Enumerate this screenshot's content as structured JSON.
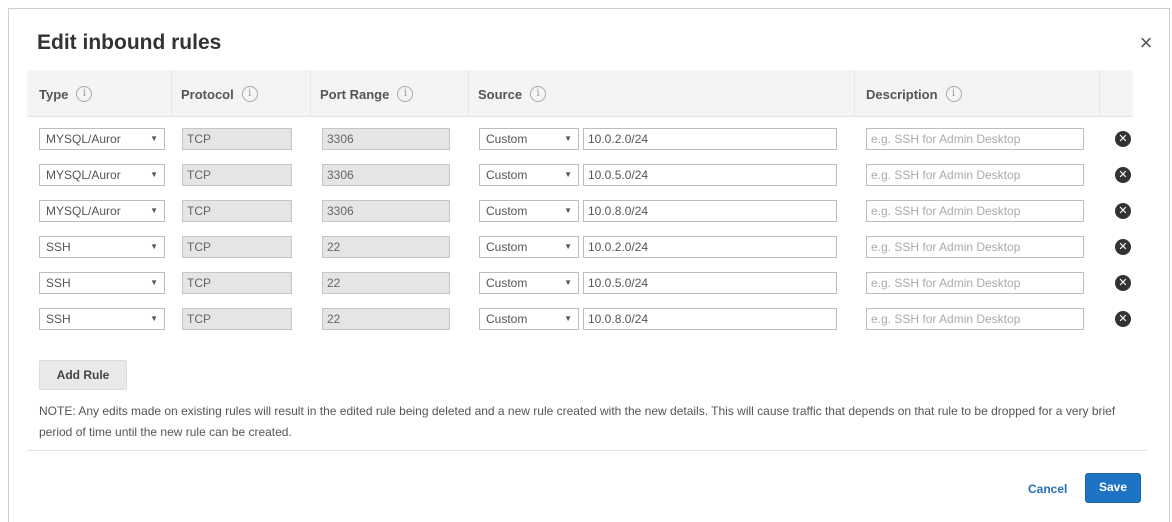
{
  "dialog": {
    "title": "Edit inbound rules",
    "close_glyph": "×"
  },
  "table": {
    "headers": {
      "type": "Type",
      "protocol": "Protocol",
      "port_range": "Port Range",
      "source": "Source",
      "description": "Description"
    },
    "info_glyph": "i",
    "rows": [
      {
        "type": "MYSQL/Auror",
        "protocol": "TCP",
        "port": "3306",
        "source_type": "Custom",
        "cidr": "10.0.2.0/24",
        "description": ""
      },
      {
        "type": "MYSQL/Auror",
        "protocol": "TCP",
        "port": "3306",
        "source_type": "Custom",
        "cidr": "10.0.5.0/24",
        "description": ""
      },
      {
        "type": "MYSQL/Auror",
        "protocol": "TCP",
        "port": "3306",
        "source_type": "Custom",
        "cidr": "10.0.8.0/24",
        "description": ""
      },
      {
        "type": "SSH",
        "protocol": "TCP",
        "port": "22",
        "source_type": "Custom",
        "cidr": "10.0.2.0/24",
        "description": ""
      },
      {
        "type": "SSH",
        "protocol": "TCP",
        "port": "22",
        "source_type": "Custom",
        "cidr": "10.0.5.0/24",
        "description": ""
      },
      {
        "type": "SSH",
        "protocol": "TCP",
        "port": "22",
        "source_type": "Custom",
        "cidr": "10.0.8.0/24",
        "description": ""
      }
    ],
    "description_placeholder": "e.g. SSH for Admin Desktop",
    "delete_glyph": "✕",
    "caret_glyph": "▼"
  },
  "actions": {
    "add_rule": "Add Rule",
    "cancel": "Cancel",
    "save": "Save"
  },
  "note": "NOTE: Any edits made on existing rules will result in the edited rule being deleted and a new rule created with the new details. This will cause traffic that depends on that rule to be dropped for a very brief period of time until the new rule can be created.",
  "colors": {
    "primary_button": "#1f73c4",
    "link": "#2a6fb3"
  }
}
